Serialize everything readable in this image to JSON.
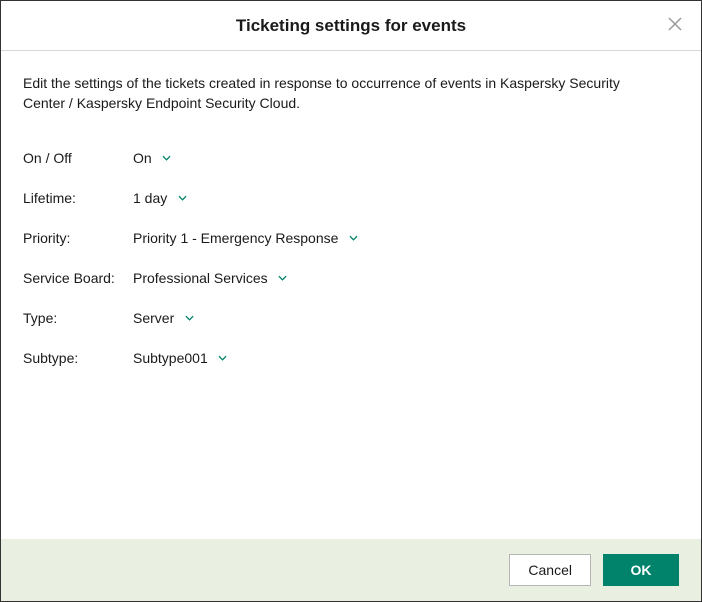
{
  "dialog": {
    "title": "Ticketing settings for events",
    "description": "Edit the settings of the tickets created in response to occurrence of events in Kaspersky Security Center / Kaspersky Endpoint Security Cloud."
  },
  "settings": {
    "onoff": {
      "label": "On / Off",
      "value": "On"
    },
    "lifetime": {
      "label": "Lifetime:",
      "value": "1 day"
    },
    "priority": {
      "label": "Priority:",
      "value": "Priority 1 - Emergency Response"
    },
    "service_board": {
      "label": "Service Board:",
      "value": "Professional Services"
    },
    "type": {
      "label": "Type:",
      "value": "Server"
    },
    "subtype": {
      "label": "Subtype:",
      "value": "Subtype001"
    }
  },
  "footer": {
    "cancel_label": "Cancel",
    "ok_label": "OK"
  },
  "colors": {
    "accent": "#00826b",
    "footer_bg": "#e9efe1"
  }
}
